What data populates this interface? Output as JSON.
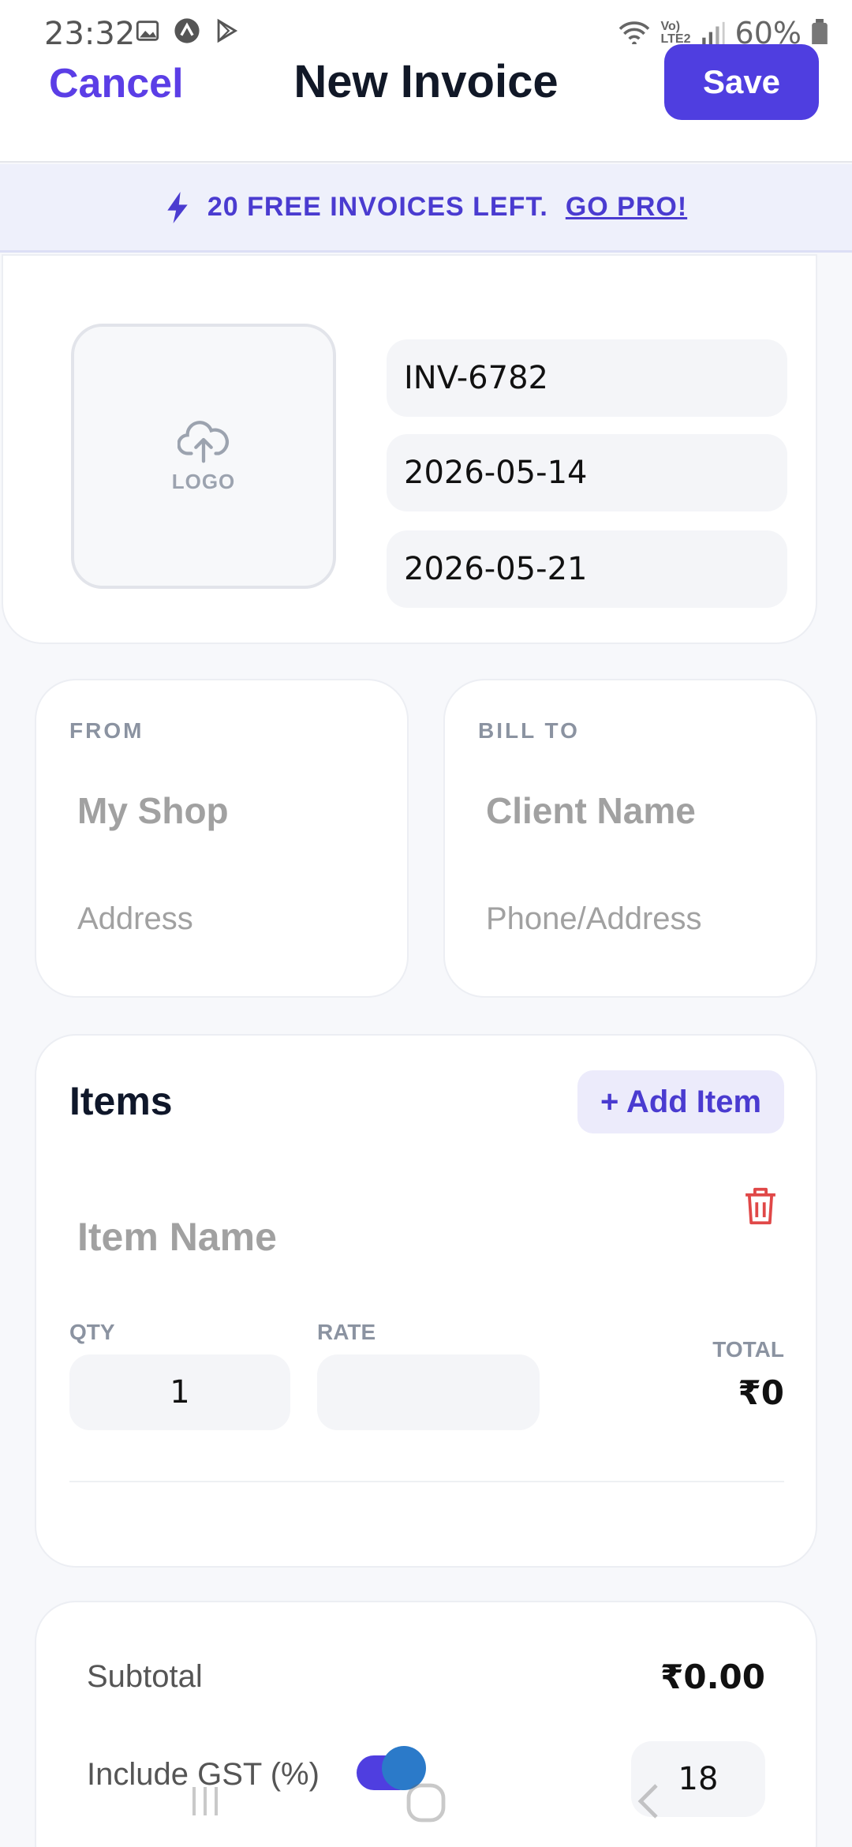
{
  "status_bar": {
    "time": "23:32",
    "battery": "60%",
    "network_label": "Vo) LTE2",
    "icons": [
      "image-icon",
      "app-icon",
      "play-store-icon",
      "wifi-icon",
      "signal-icon",
      "battery-icon"
    ]
  },
  "header": {
    "cancel_label": "Cancel",
    "title": "New Invoice",
    "save_label": "Save"
  },
  "banner": {
    "icon": "lightning-icon",
    "text": "20 FREE INVOICES LEFT.",
    "link": "GO PRO!"
  },
  "invoice": {
    "logo_label": "LOGO",
    "number": "INV-6782",
    "issue_date": "2026-05-14",
    "due_date": "2026-05-21"
  },
  "from": {
    "label": "FROM",
    "name_placeholder": "My Shop",
    "address_placeholder": "Address"
  },
  "bill_to": {
    "label": "BILL TO",
    "name_placeholder": "Client Name",
    "address_placeholder": "Phone/Address"
  },
  "items": {
    "title": "Items",
    "add_label": "+ Add Item",
    "rows": [
      {
        "name_placeholder": "Item Name",
        "qty_label": "QTY",
        "qty": "1",
        "rate_label": "RATE",
        "rate": "",
        "total_label": "TOTAL",
        "total": "₹0"
      }
    ]
  },
  "totals": {
    "subtotal_label": "Subtotal",
    "subtotal": "₹0.00",
    "gst_label": "Include GST (%)",
    "gst_enabled": true,
    "gst_rate": "18"
  },
  "colors": {
    "accent": "#4f3ee0",
    "banner_bg": "#eef0fb",
    "delete": "#e04848"
  }
}
